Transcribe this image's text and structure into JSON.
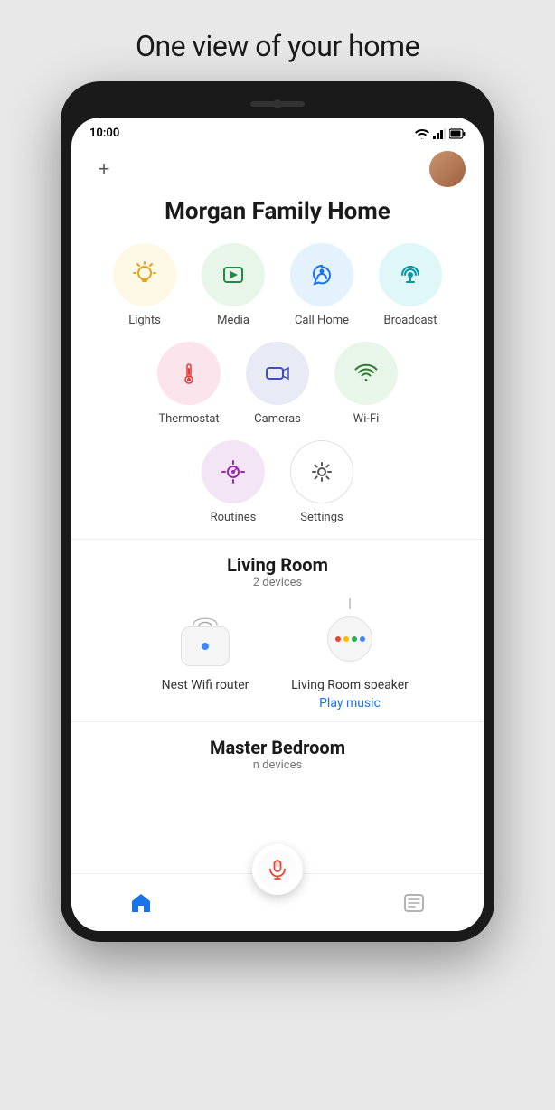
{
  "page": {
    "title": "One view of your home"
  },
  "statusBar": {
    "time": "10:00"
  },
  "homeScreen": {
    "title": "Morgan Family Home",
    "shortcuts": {
      "row1": [
        {
          "id": "lights",
          "label": "Lights",
          "color": "yellow"
        },
        {
          "id": "media",
          "label": "Media",
          "color": "green"
        },
        {
          "id": "callhome",
          "label": "Call Home",
          "color": "blue"
        },
        {
          "id": "broadcast",
          "label": "Broadcast",
          "color": "teal"
        }
      ],
      "row2": [
        {
          "id": "thermostat",
          "label": "Thermostat",
          "color": "red"
        },
        {
          "id": "cameras",
          "label": "Cameras",
          "color": "blue2"
        },
        {
          "id": "wifi",
          "label": "Wi-Fi",
          "color": "green2"
        }
      ],
      "row3": [
        {
          "id": "routines",
          "label": "Routines",
          "color": "purple"
        },
        {
          "id": "settings",
          "label": "Settings",
          "color": "white"
        }
      ]
    },
    "rooms": [
      {
        "name": "Living Room",
        "deviceCount": "2 devices",
        "devices": [
          {
            "id": "nest-wifi",
            "label": "Nest Wifi router",
            "hasAction": false
          },
          {
            "id": "lr-speaker",
            "label": "Living Room speaker",
            "hasAction": true,
            "actionLabel": "Play music"
          }
        ]
      },
      {
        "name": "Master Bedroom",
        "deviceCountPartial": "n devices",
        "partial": true
      }
    ]
  },
  "nav": {
    "home": "home",
    "list": "list"
  },
  "addButton": "+",
  "micButton": "mic"
}
